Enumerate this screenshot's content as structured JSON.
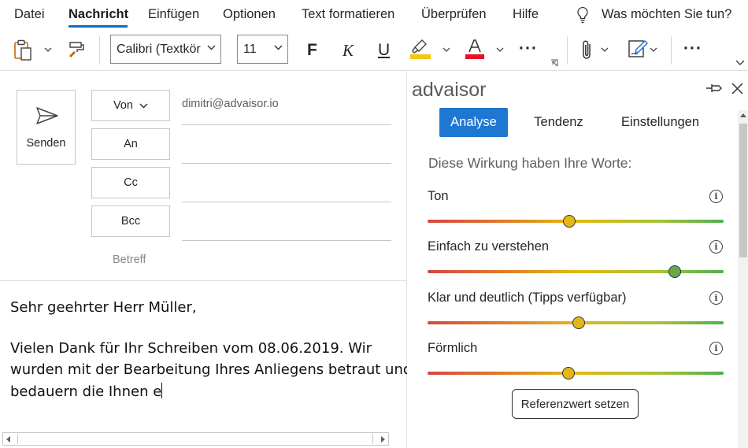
{
  "menubar": {
    "items": [
      "Datei",
      "Nachricht",
      "Einfügen",
      "Optionen",
      "Text formatieren",
      "Überprüfen",
      "Hilfe"
    ],
    "active": "Nachricht",
    "tell_me": "Was möchten Sie tun?"
  },
  "toolbar": {
    "font_name": "Calibri (Textkör",
    "font_size": "11",
    "bold": "F",
    "italic": "K",
    "underline": "U",
    "highlight_color": "#f2c811",
    "font_color": "#e81123",
    "more": "···"
  },
  "compose": {
    "send_label": "Senden",
    "from_label": "Von",
    "to_label": "An",
    "cc_label": "Cc",
    "bcc_label": "Bcc",
    "from_value": "dimitri@advaisor.io",
    "subject_label": "Betreff",
    "body_lines": [
      "Sehr geehrter Herr Müller,",
      "Vielen Dank für Ihr Schreiben vom 08.06.2019. Wir",
      "wurden mit der Bearbeitung Ihres Anliegens betraut und",
      "bedauern die Ihnen e"
    ]
  },
  "pane": {
    "title": "advaisor",
    "tabs": [
      "Analyse",
      "Tendenz",
      "Einstellungen"
    ],
    "active_tab": "Analyse",
    "heading": "Diese Wirkung haben Ihre Worte:",
    "metrics": [
      {
        "label": "Ton",
        "value": 0.48,
        "knob_color": "#e2b814"
      },
      {
        "label": "Einfach zu verstehen",
        "value": 0.835,
        "knob_color": "#6aa84f"
      },
      {
        "label": "Klar und deutlich (Tipps verfügbar)",
        "value": 0.51,
        "knob_color": "#e2b814"
      },
      {
        "label": "Förmlich",
        "value": 0.475,
        "knob_color": "#e2b814"
      }
    ],
    "info_glyph": "i",
    "reference_button": "Referenzwert setzen"
  },
  "colors": {
    "accent": "#1e78d2",
    "menu_underline": "#106ebe"
  }
}
